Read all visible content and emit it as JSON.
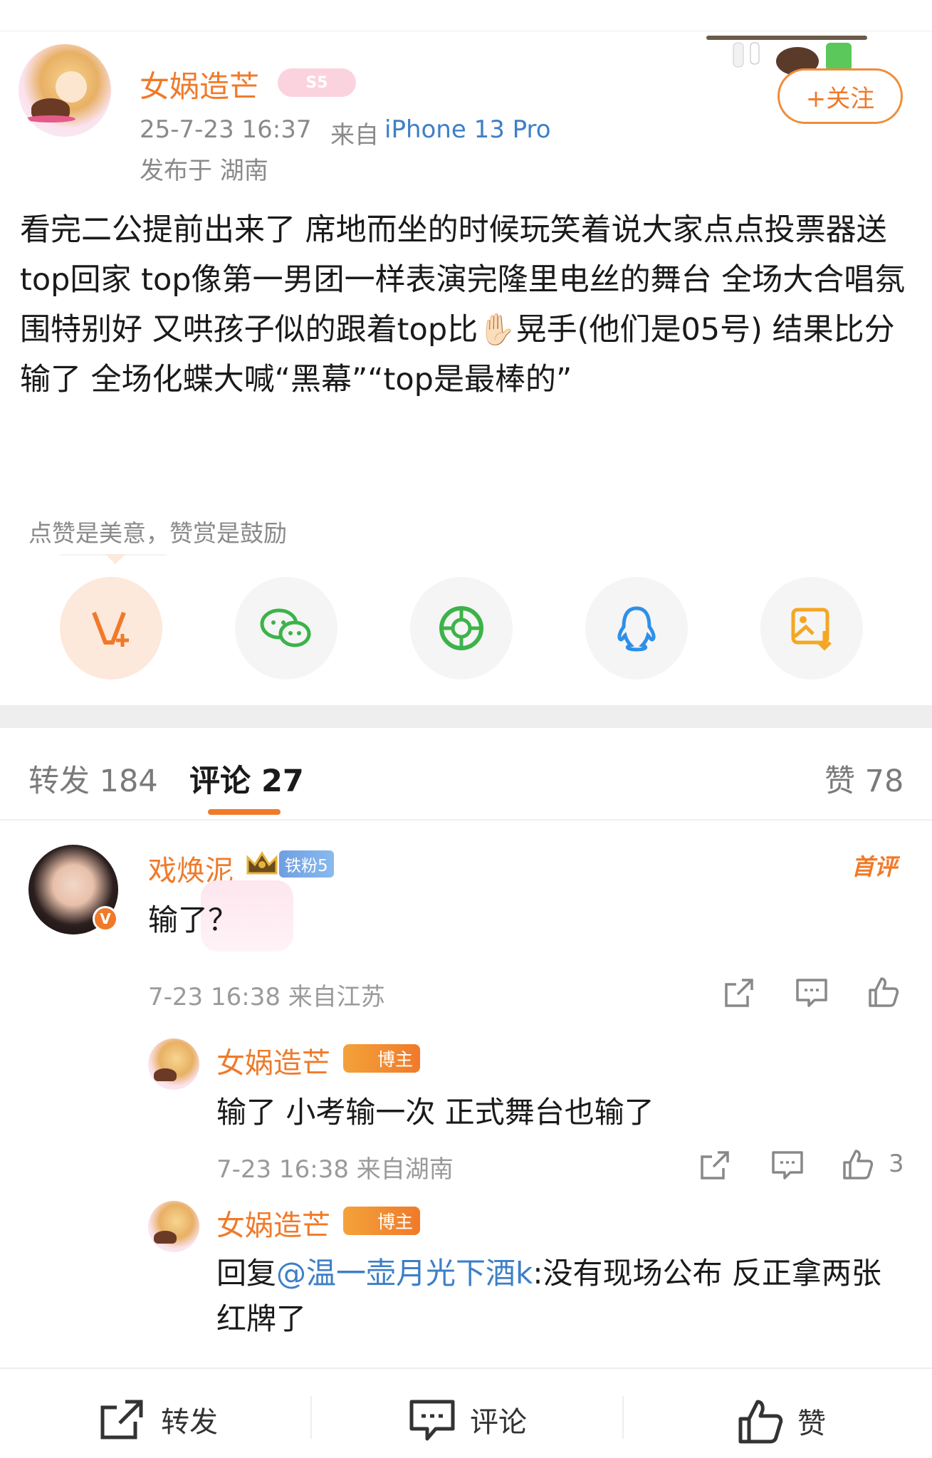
{
  "post": {
    "username": "女娲造芒",
    "vip_badge": "S5",
    "time": "25-7-23 16:37",
    "source_prefix": "来自",
    "device": "iPhone 13 Pro",
    "location": "发布于 湖南",
    "follow_label": "+关注",
    "body": "看完二公提前出来了 席地而坐的时候玩笑着说大家点点投票器送top回家 top像第一男团一样表演完隆里电丝的舞台 全场大合唱氛围特别好 又哄孩子似的跟着top比✋🏻晃手(他们是05号) 结果比分输了 全场化蝶大喊“黑幕”“top是最棒的”"
  },
  "reward_hint": "点赞是美意，赞赏是鼓励",
  "share_targets": [
    {
      "icon": "reward-v-icon",
      "color": "#f07a2a"
    },
    {
      "icon": "wechat-icon",
      "color": "#3cb34a"
    },
    {
      "icon": "moments-icon",
      "color": "#3cb34a"
    },
    {
      "icon": "qq-icon",
      "color": "#2f8fe8"
    },
    {
      "icon": "save-image-icon",
      "color": "#f5a623"
    }
  ],
  "tabs": {
    "repost": "转发 184",
    "comments": "评论 27",
    "likes": "赞 78"
  },
  "comments": [
    {
      "username": "戏焕泥",
      "fan_badge": "铁粉5",
      "first_label": "首评",
      "text": "输了？",
      "meta": "7-23 16:38 来自江苏",
      "replies": [
        {
          "username": "女娲造芒",
          "badge": "博主",
          "text": "输了 小考输一次 正式舞台也输了",
          "meta": "7-23 16:38 来自湖南",
          "likes": "3"
        },
        {
          "username": "女娲造芒",
          "badge": "博主",
          "reply_prefix": "回复",
          "mention": "@温一壶月光下酒k",
          "text": ":没有现场公布 反正拿两张红牌了"
        }
      ]
    }
  ],
  "bottom_bar": {
    "repost": "转发",
    "comment": "评论",
    "like": "赞"
  }
}
